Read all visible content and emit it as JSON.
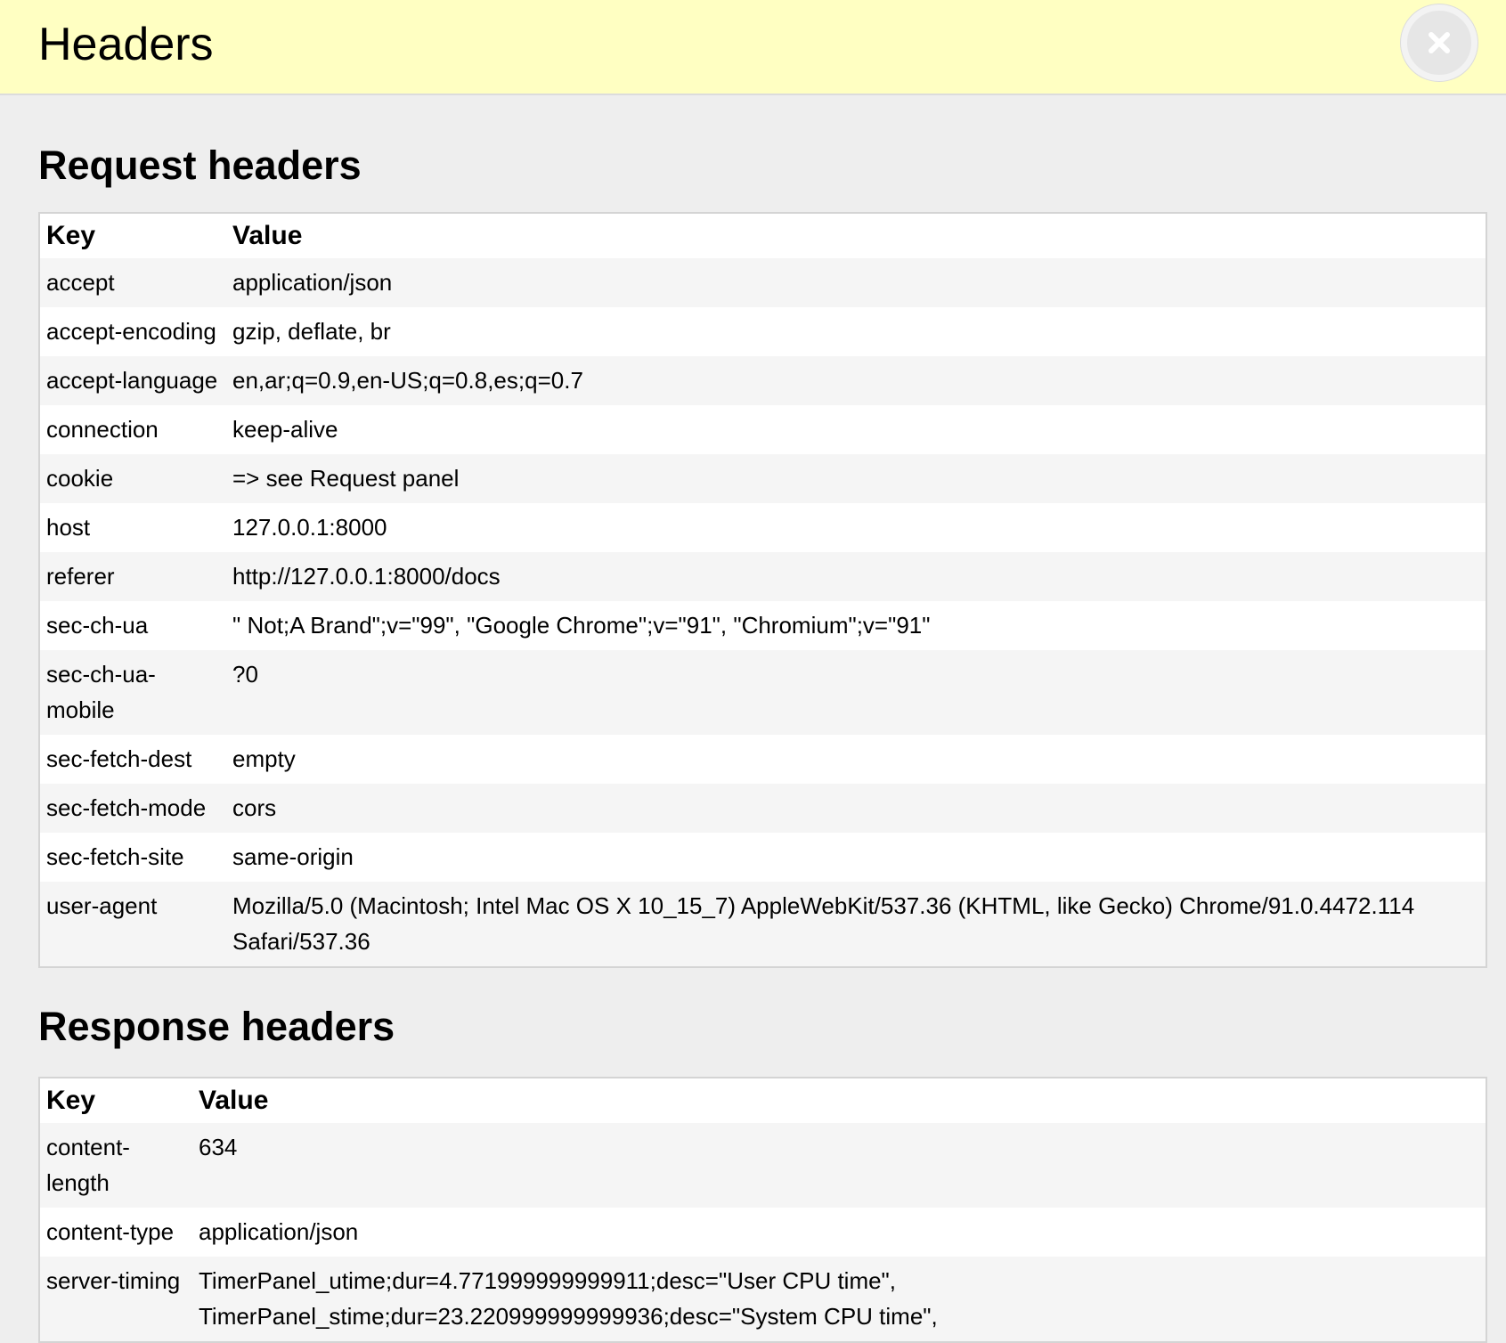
{
  "panel": {
    "title": "Headers",
    "close_icon": "close-icon"
  },
  "request": {
    "title": "Request headers",
    "columns": [
      "Key",
      "Value"
    ],
    "rows": [
      {
        "key": "accept",
        "value": "application/json"
      },
      {
        "key": "accept-encoding",
        "value": "gzip, deflate, br"
      },
      {
        "key": "accept-language",
        "value": "en,ar;q=0.9,en-US;q=0.8,es;q=0.7"
      },
      {
        "key": "connection",
        "value": "keep-alive"
      },
      {
        "key": "cookie",
        "value": "=> see Request panel"
      },
      {
        "key": "host",
        "value": "127.0.0.1:8000"
      },
      {
        "key": "referer",
        "value": "http://127.0.0.1:8000/docs"
      },
      {
        "key": "sec-ch-ua",
        "value": "\" Not;A Brand\";v=\"99\", \"Google Chrome\";v=\"91\", \"Chromium\";v=\"91\""
      },
      {
        "key": "sec-ch-ua-mobile",
        "value": "?0"
      },
      {
        "key": "sec-fetch-dest",
        "value": "empty"
      },
      {
        "key": "sec-fetch-mode",
        "value": "cors"
      },
      {
        "key": "sec-fetch-site",
        "value": "same-origin"
      },
      {
        "key": "user-agent",
        "value": "Mozilla/5.0 (Macintosh; Intel Mac OS X 10_15_7) AppleWebKit/537.36 (KHTML, like Gecko) Chrome/91.0.4472.114 Safari/537.36"
      }
    ]
  },
  "response": {
    "title": "Response headers",
    "columns": [
      "Key",
      "Value"
    ],
    "rows": [
      {
        "key": "content-length",
        "value": "634"
      },
      {
        "key": "content-type",
        "value": "application/json"
      },
      {
        "key": "server-timing",
        "value": "TimerPanel_utime;dur=4.771999999999911;desc=\"User CPU time\", TimerPanel_stime;dur=23.220999999999936;desc=\"System CPU time\","
      }
    ]
  },
  "colors": {
    "header_background": "#ffffc2",
    "page_background": "#eeeeee",
    "striped_row": "#f5f5f5"
  }
}
